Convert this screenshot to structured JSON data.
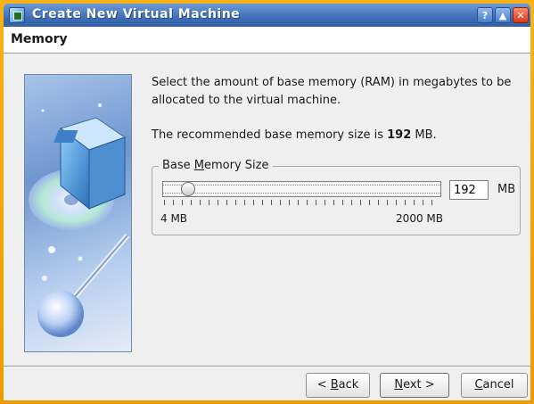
{
  "window": {
    "title": "Create New Virtual Machine",
    "controls": {
      "help": "?",
      "rollup": "▲",
      "close": "✕"
    }
  },
  "page": {
    "title": "Memory"
  },
  "content": {
    "description_line1": "Select the amount of base memory (RAM) in megabytes to be",
    "description_line2": "allocated to the virtual machine.",
    "recommended_prefix": "The recommended base memory size is ",
    "recommended_value": "192",
    "recommended_suffix": " MB."
  },
  "memory": {
    "group_label_pre": "Base ",
    "group_label_mnemonic": "M",
    "group_label_post": "emory Size",
    "value": "192",
    "unit": "MB",
    "min_label": "4 MB",
    "max_label": "2000 MB"
  },
  "buttons": {
    "back_pre": "< ",
    "back_mnemonic": "B",
    "back_post": "ack",
    "next_mnemonic": "N",
    "next_post": "ext >",
    "cancel_mnemonic": "C",
    "cancel_post": "ancel"
  },
  "colors": {
    "titlebar": "#3f6fb8",
    "frame": "#f6a600",
    "dialog_bg": "#efefef"
  }
}
